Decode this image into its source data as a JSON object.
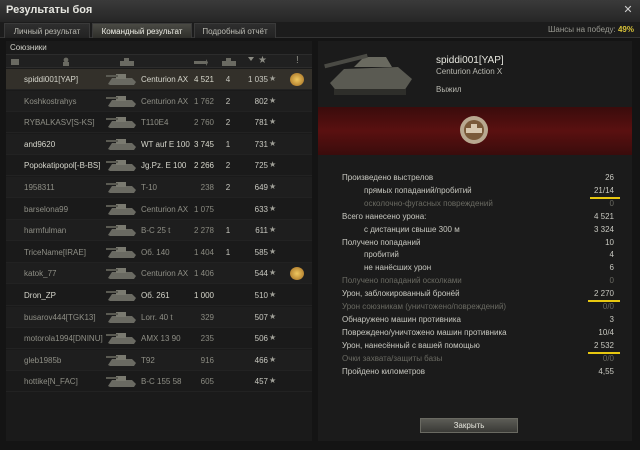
{
  "window": {
    "title": "Результаты боя",
    "close": "✕"
  },
  "tabs": [
    {
      "label": "Личный результат",
      "active": false
    },
    {
      "label": "Командный результат",
      "active": true
    },
    {
      "label": "Подробный отчёт",
      "active": false
    }
  ],
  "win_chance": {
    "label": "Шансы на победу:",
    "value": "49%"
  },
  "allies_label": "Союзники",
  "column_icons": [
    "platoon-icon",
    "player-icon",
    "tank-icon",
    "damage-icon",
    "kills-icon",
    "xp-star-icon",
    "achievement-icon"
  ],
  "players": [
    {
      "name": "spiddi001[YAP]",
      "tank": "Centurion AX",
      "damage": "4 521",
      "kills": "4",
      "xp": "1 035",
      "alive": true,
      "medal": true,
      "me": true
    },
    {
      "name": "Koshkostrahys",
      "tank": "Centurion AX",
      "damage": "1 762",
      "kills": "2",
      "xp": "802",
      "alive": false,
      "medal": false
    },
    {
      "name": "RYBALKASV[S-KS]",
      "tank": "T110E4",
      "damage": "2 760",
      "kills": "2",
      "xp": "781",
      "alive": false,
      "medal": false
    },
    {
      "name": "and9620",
      "tank": "WT auf E 100",
      "damage": "3 745",
      "kills": "1",
      "xp": "731",
      "alive": true,
      "medal": false
    },
    {
      "name": "Popokatipopol[-B-BS]",
      "tank": "Jg.Pz. E 100",
      "damage": "2 266",
      "kills": "2",
      "xp": "725",
      "alive": true,
      "medal": false
    },
    {
      "name": "1958311",
      "tank": "T-10",
      "damage": "238",
      "kills": "2",
      "xp": "649",
      "alive": false,
      "medal": false
    },
    {
      "name": "barselona99",
      "tank": "Centurion AX",
      "damage": "1 075",
      "kills": "",
      "xp": "633",
      "alive": false,
      "medal": false
    },
    {
      "name": "harmfulman",
      "tank": "B-C 25 t",
      "damage": "2 278",
      "kills": "1",
      "xp": "611",
      "alive": false,
      "medal": false
    },
    {
      "name": "TriceName[IRAE]",
      "tank": "Об. 140",
      "damage": "1 404",
      "kills": "1",
      "xp": "585",
      "alive": false,
      "medal": false
    },
    {
      "name": "katok_77",
      "tank": "Centurion AX",
      "damage": "1 406",
      "kills": "",
      "xp": "544",
      "alive": false,
      "medal": true
    },
    {
      "name": "Dron_ZP",
      "tank": "Об. 261",
      "damage": "1 000",
      "kills": "",
      "xp": "510",
      "alive": true,
      "medal": false
    },
    {
      "name": "busarov444[TGK13]",
      "tank": "Lorr. 40 t",
      "damage": "329",
      "kills": "",
      "xp": "507",
      "alive": false,
      "medal": false
    },
    {
      "name": "motorola1994[DNINU]",
      "tank": "AMX 13 90",
      "damage": "235",
      "kills": "",
      "xp": "506",
      "alive": false,
      "medal": false
    },
    {
      "name": "gleb1985b",
      "tank": "T92",
      "damage": "916",
      "kills": "",
      "xp": "466",
      "alive": false,
      "medal": false
    },
    {
      "name": "hottike[N_FAC]",
      "tank": "B-C 155 58",
      "damage": "605",
      "kills": "",
      "xp": "457",
      "alive": false,
      "medal": false
    }
  ],
  "player_detail": {
    "name": "spiddi001[YAP]",
    "tank": "Centurion Action X",
    "status": "Выжил"
  },
  "stats": [
    {
      "label": "Произведено выстрелов",
      "value": "26",
      "indent": false,
      "dim": false,
      "highlight": false
    },
    {
      "label": "прямых попаданий/пробитий",
      "value": "21/14",
      "indent": true,
      "dim": false,
      "highlight": true
    },
    {
      "label": "осколочно-фугасных повреждений",
      "value": "0",
      "indent": true,
      "dim": true,
      "highlight": false
    },
    {
      "label": "Всего нанесено урона:",
      "value": "4 521",
      "indent": false,
      "dim": false,
      "highlight": false
    },
    {
      "label": "с дистанции свыше 300 м",
      "value": "3 324",
      "indent": true,
      "dim": false,
      "highlight": false
    },
    {
      "label": "Получено попаданий",
      "value": "10",
      "indent": false,
      "dim": false,
      "highlight": false
    },
    {
      "label": "пробитий",
      "value": "4",
      "indent": true,
      "dim": false,
      "highlight": false
    },
    {
      "label": "не нанёсших урон",
      "value": "6",
      "indent": true,
      "dim": false,
      "highlight": false
    },
    {
      "label": "Получено попаданий осколками",
      "value": "0",
      "indent": false,
      "dim": true,
      "highlight": false
    },
    {
      "label": "Урон, заблокированный бронёй",
      "value": "2 270",
      "indent": false,
      "dim": false,
      "highlight": true
    },
    {
      "label": "Урон союзникам (уничтожено/повреждений)",
      "value": "0/0",
      "indent": false,
      "dim": true,
      "highlight": false
    },
    {
      "label": "Обнаружено машин противника",
      "value": "3",
      "indent": false,
      "dim": false,
      "highlight": false
    },
    {
      "label": "Повреждено/уничтожено машин противника",
      "value": "10/4",
      "indent": false,
      "dim": false,
      "highlight": false
    },
    {
      "label": "Урон, нанесённый с вашей помощью",
      "value": "2 532",
      "indent": false,
      "dim": false,
      "highlight": true
    },
    {
      "label": "Очки захвата/защиты базы",
      "value": "0/0",
      "indent": false,
      "dim": true,
      "highlight": false
    },
    {
      "label": "Пройдено километров",
      "value": "4,55",
      "indent": false,
      "dim": false,
      "highlight": false
    }
  ],
  "close_button": "Закрыть",
  "colors": {
    "accent": "#d8c238",
    "banner": "#5a1010",
    "highlight_underline": "#e8c810"
  }
}
